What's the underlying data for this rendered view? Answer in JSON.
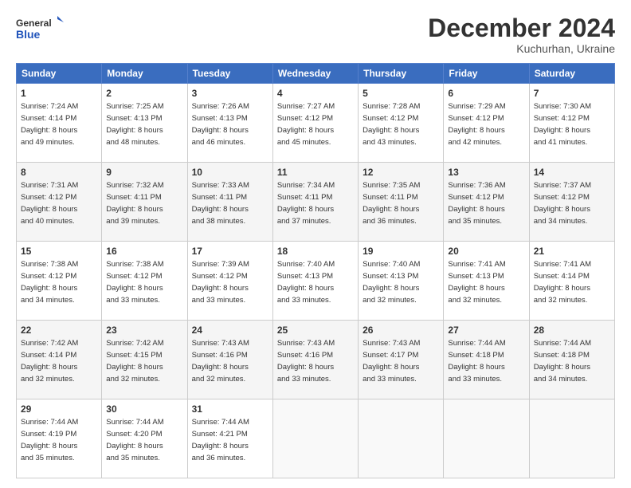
{
  "header": {
    "logo_line1": "General",
    "logo_line2": "Blue",
    "month": "December 2024",
    "location": "Kuchurhan, Ukraine"
  },
  "weekdays": [
    "Sunday",
    "Monday",
    "Tuesday",
    "Wednesday",
    "Thursday",
    "Friday",
    "Saturday"
  ],
  "weeks": [
    [
      {
        "day": "1",
        "sunrise": "Sunrise: 7:24 AM",
        "sunset": "Sunset: 4:14 PM",
        "daylight": "Daylight: 8 hours and 49 minutes."
      },
      {
        "day": "2",
        "sunrise": "Sunrise: 7:25 AM",
        "sunset": "Sunset: 4:13 PM",
        "daylight": "Daylight: 8 hours and 48 minutes."
      },
      {
        "day": "3",
        "sunrise": "Sunrise: 7:26 AM",
        "sunset": "Sunset: 4:13 PM",
        "daylight": "Daylight: 8 hours and 46 minutes."
      },
      {
        "day": "4",
        "sunrise": "Sunrise: 7:27 AM",
        "sunset": "Sunset: 4:12 PM",
        "daylight": "Daylight: 8 hours and 45 minutes."
      },
      {
        "day": "5",
        "sunrise": "Sunrise: 7:28 AM",
        "sunset": "Sunset: 4:12 PM",
        "daylight": "Daylight: 8 hours and 43 minutes."
      },
      {
        "day": "6",
        "sunrise": "Sunrise: 7:29 AM",
        "sunset": "Sunset: 4:12 PM",
        "daylight": "Daylight: 8 hours and 42 minutes."
      },
      {
        "day": "7",
        "sunrise": "Sunrise: 7:30 AM",
        "sunset": "Sunset: 4:12 PM",
        "daylight": "Daylight: 8 hours and 41 minutes."
      }
    ],
    [
      {
        "day": "8",
        "sunrise": "Sunrise: 7:31 AM",
        "sunset": "Sunset: 4:12 PM",
        "daylight": "Daylight: 8 hours and 40 minutes."
      },
      {
        "day": "9",
        "sunrise": "Sunrise: 7:32 AM",
        "sunset": "Sunset: 4:11 PM",
        "daylight": "Daylight: 8 hours and 39 minutes."
      },
      {
        "day": "10",
        "sunrise": "Sunrise: 7:33 AM",
        "sunset": "Sunset: 4:11 PM",
        "daylight": "Daylight: 8 hours and 38 minutes."
      },
      {
        "day": "11",
        "sunrise": "Sunrise: 7:34 AM",
        "sunset": "Sunset: 4:11 PM",
        "daylight": "Daylight: 8 hours and 37 minutes."
      },
      {
        "day": "12",
        "sunrise": "Sunrise: 7:35 AM",
        "sunset": "Sunset: 4:11 PM",
        "daylight": "Daylight: 8 hours and 36 minutes."
      },
      {
        "day": "13",
        "sunrise": "Sunrise: 7:36 AM",
        "sunset": "Sunset: 4:12 PM",
        "daylight": "Daylight: 8 hours and 35 minutes."
      },
      {
        "day": "14",
        "sunrise": "Sunrise: 7:37 AM",
        "sunset": "Sunset: 4:12 PM",
        "daylight": "Daylight: 8 hours and 34 minutes."
      }
    ],
    [
      {
        "day": "15",
        "sunrise": "Sunrise: 7:38 AM",
        "sunset": "Sunset: 4:12 PM",
        "daylight": "Daylight: 8 hours and 34 minutes."
      },
      {
        "day": "16",
        "sunrise": "Sunrise: 7:38 AM",
        "sunset": "Sunset: 4:12 PM",
        "daylight": "Daylight: 8 hours and 33 minutes."
      },
      {
        "day": "17",
        "sunrise": "Sunrise: 7:39 AM",
        "sunset": "Sunset: 4:12 PM",
        "daylight": "Daylight: 8 hours and 33 minutes."
      },
      {
        "day": "18",
        "sunrise": "Sunrise: 7:40 AM",
        "sunset": "Sunset: 4:13 PM",
        "daylight": "Daylight: 8 hours and 33 minutes."
      },
      {
        "day": "19",
        "sunrise": "Sunrise: 7:40 AM",
        "sunset": "Sunset: 4:13 PM",
        "daylight": "Daylight: 8 hours and 32 minutes."
      },
      {
        "day": "20",
        "sunrise": "Sunrise: 7:41 AM",
        "sunset": "Sunset: 4:13 PM",
        "daylight": "Daylight: 8 hours and 32 minutes."
      },
      {
        "day": "21",
        "sunrise": "Sunrise: 7:41 AM",
        "sunset": "Sunset: 4:14 PM",
        "daylight": "Daylight: 8 hours and 32 minutes."
      }
    ],
    [
      {
        "day": "22",
        "sunrise": "Sunrise: 7:42 AM",
        "sunset": "Sunset: 4:14 PM",
        "daylight": "Daylight: 8 hours and 32 minutes."
      },
      {
        "day": "23",
        "sunrise": "Sunrise: 7:42 AM",
        "sunset": "Sunset: 4:15 PM",
        "daylight": "Daylight: 8 hours and 32 minutes."
      },
      {
        "day": "24",
        "sunrise": "Sunrise: 7:43 AM",
        "sunset": "Sunset: 4:16 PM",
        "daylight": "Daylight: 8 hours and 32 minutes."
      },
      {
        "day": "25",
        "sunrise": "Sunrise: 7:43 AM",
        "sunset": "Sunset: 4:16 PM",
        "daylight": "Daylight: 8 hours and 33 minutes."
      },
      {
        "day": "26",
        "sunrise": "Sunrise: 7:43 AM",
        "sunset": "Sunset: 4:17 PM",
        "daylight": "Daylight: 8 hours and 33 minutes."
      },
      {
        "day": "27",
        "sunrise": "Sunrise: 7:44 AM",
        "sunset": "Sunset: 4:18 PM",
        "daylight": "Daylight: 8 hours and 33 minutes."
      },
      {
        "day": "28",
        "sunrise": "Sunrise: 7:44 AM",
        "sunset": "Sunset: 4:18 PM",
        "daylight": "Daylight: 8 hours and 34 minutes."
      }
    ],
    [
      {
        "day": "29",
        "sunrise": "Sunrise: 7:44 AM",
        "sunset": "Sunset: 4:19 PM",
        "daylight": "Daylight: 8 hours and 35 minutes."
      },
      {
        "day": "30",
        "sunrise": "Sunrise: 7:44 AM",
        "sunset": "Sunset: 4:20 PM",
        "daylight": "Daylight: 8 hours and 35 minutes."
      },
      {
        "day": "31",
        "sunrise": "Sunrise: 7:44 AM",
        "sunset": "Sunset: 4:21 PM",
        "daylight": "Daylight: 8 hours and 36 minutes."
      },
      null,
      null,
      null,
      null
    ]
  ]
}
